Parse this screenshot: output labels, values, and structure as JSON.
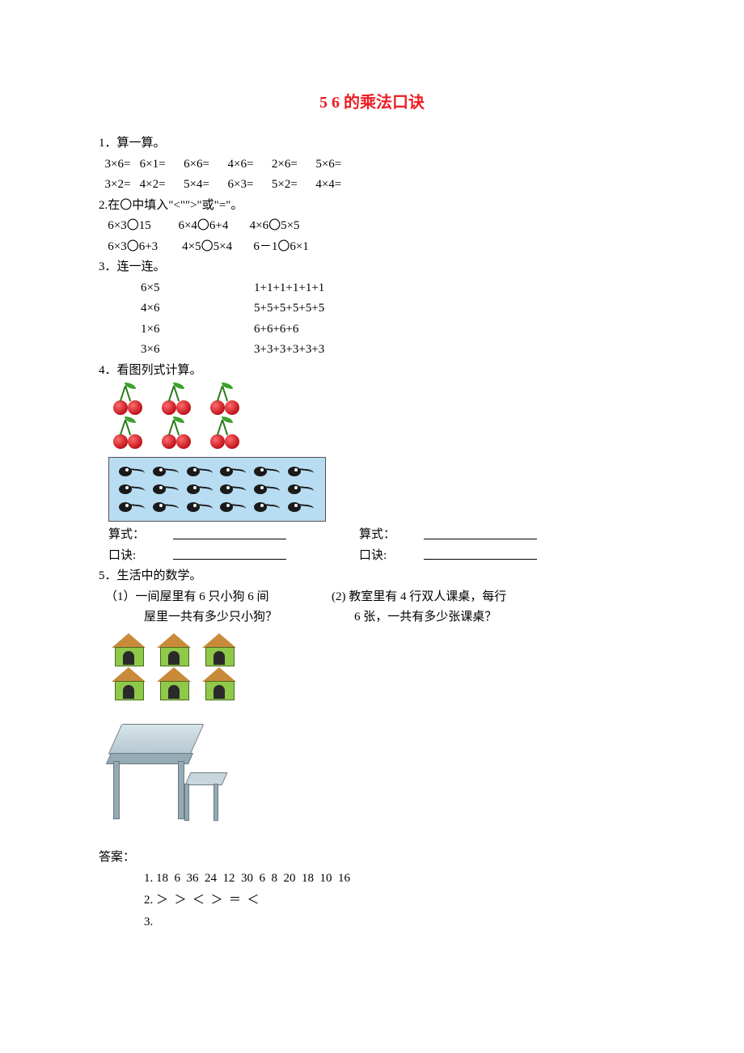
{
  "title": "5  6 的乘法口诀",
  "q1": {
    "heading": "1．算一算。",
    "row1": "  3×6=   6×1=      6×6=      4×6=      2×6=      5×6=",
    "row2": "  3×2=   4×2=      5×4=      6×3=      5×2=      4×4="
  },
  "q2": {
    "heading": "2.在〇中填入\"<\"\">\"或\"=\"。",
    "row1": "   6×3〇15         6×4〇6+4       4×6〇5×5",
    "row2": "   6×3〇6+3        4×5〇5×4       6－1〇6×1"
  },
  "q3": {
    "heading": "3．连一连。",
    "pairs": [
      {
        "a": "6×5",
        "b": "1+1+1+1+1+1"
      },
      {
        "a": "4×6",
        "b": "5+5+5+5+5+5"
      },
      {
        "a": "1×6",
        "b": "6+6+6+6"
      },
      {
        "a": "3×6",
        "b": "3+3+3+3+3+3"
      }
    ]
  },
  "q4": {
    "heading": "4．看图列式计算。",
    "labels": {
      "expr": "算式：",
      "expr2": "算式：",
      "formula": "口诀:",
      "formula2": "口诀:"
    }
  },
  "q5": {
    "heading": "5．生活中的数学。",
    "p1a": "（1）一间屋里有 6 只小狗 6 间",
    "p1b": "屋里一共有多少只小狗？",
    "p2a": "(2) 教室里有 4 行双人课桌，每行",
    "p2b": "6 张，一共有多少张课桌？"
  },
  "answers": {
    "heading": "答案：",
    "a1": "1. 18  6  36  24  12  30  6  8  20  18  10  16",
    "a2": "2. ＞  ＞  ＜  ＞  ＝  ＜",
    "a3": "3."
  }
}
